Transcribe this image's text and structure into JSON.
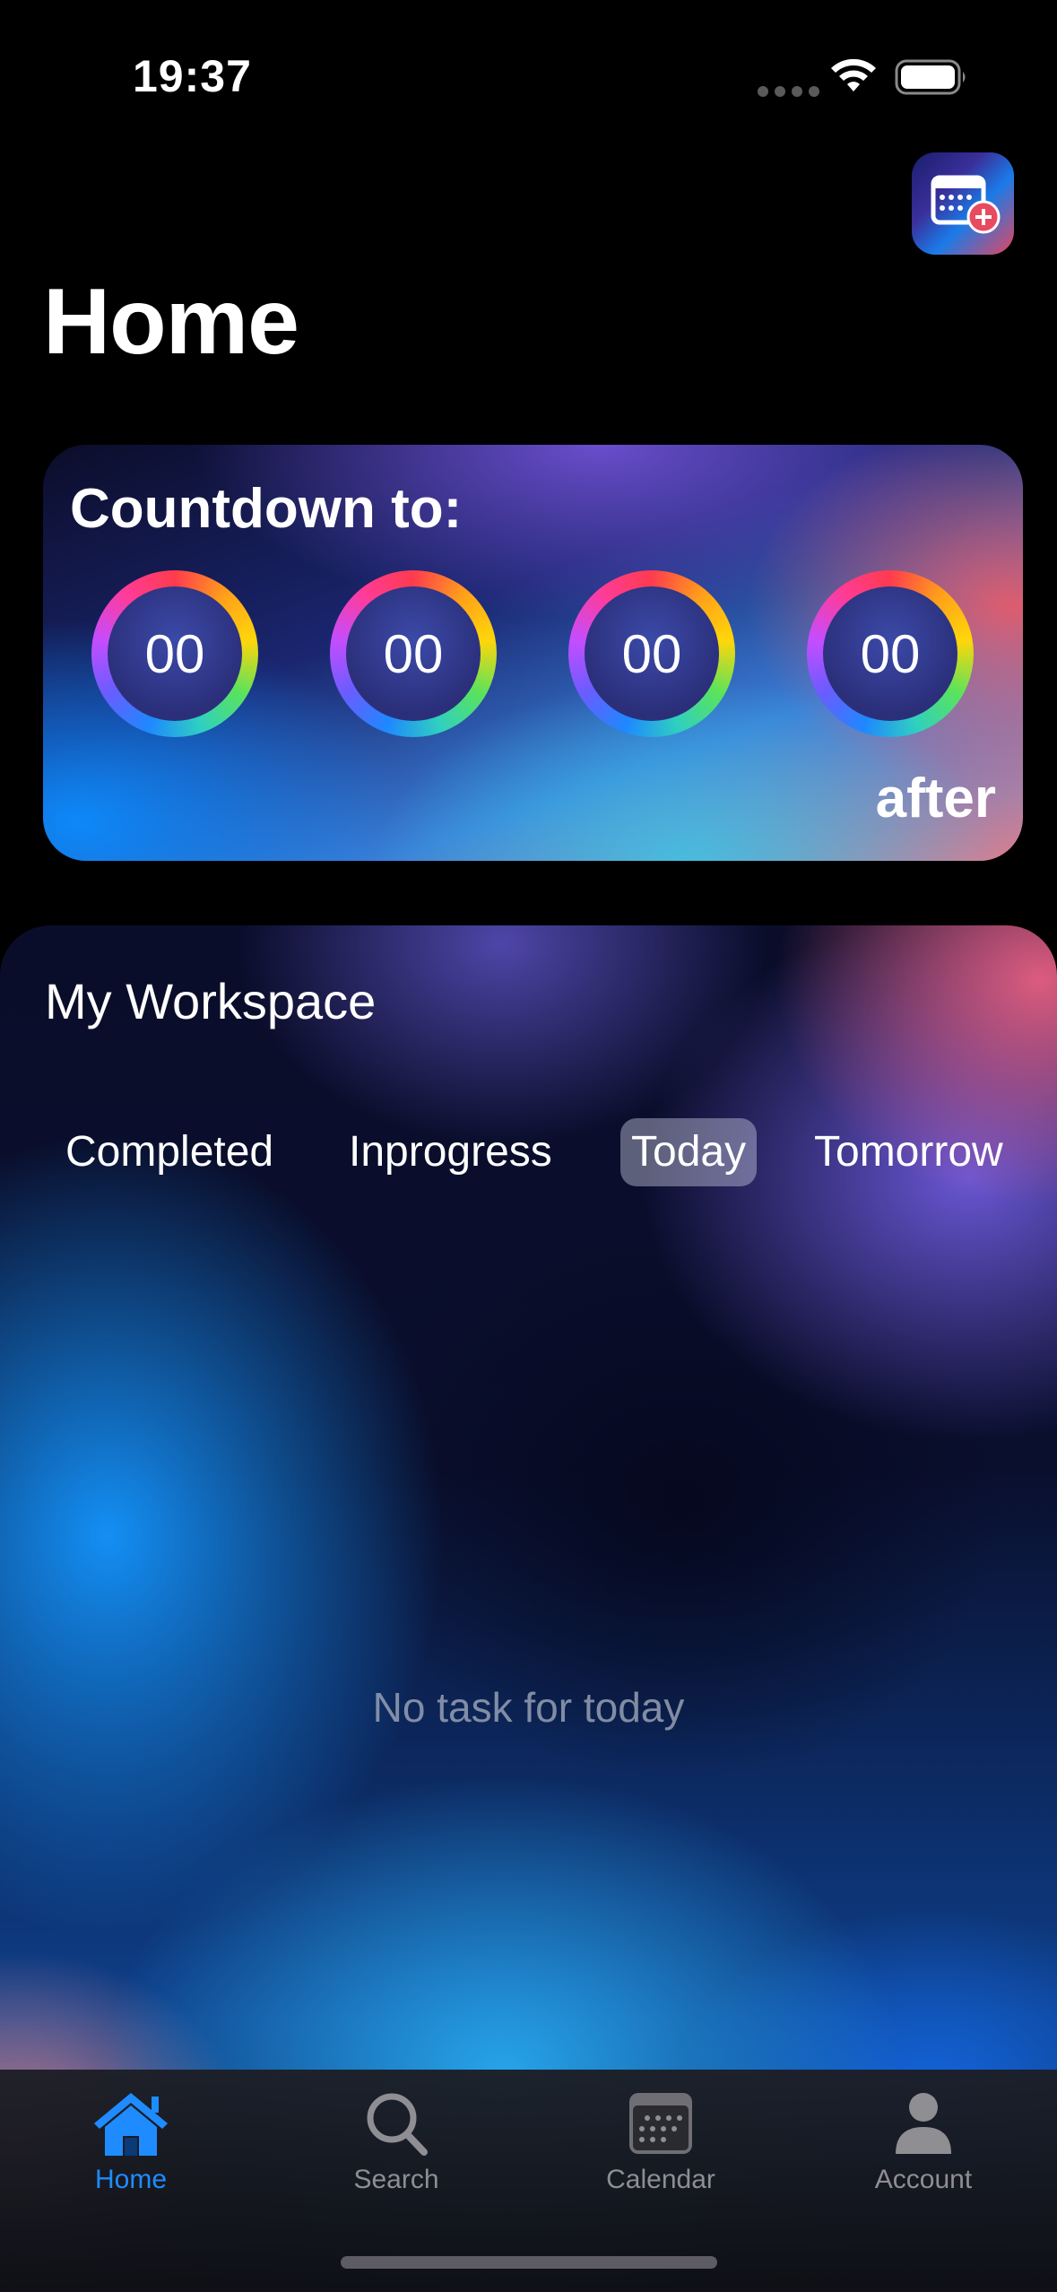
{
  "status_bar": {
    "time": "19:37"
  },
  "header": {
    "title": "Home",
    "add_event_icon": "calendar-add-icon"
  },
  "countdown": {
    "title": "Countdown to:",
    "units": [
      "00",
      "00",
      "00",
      "00"
    ],
    "footer": "after"
  },
  "workspace": {
    "title": "My Workspace",
    "tabs": [
      {
        "label": "Completed",
        "active": false
      },
      {
        "label": "Inprogress",
        "active": false
      },
      {
        "label": "Today",
        "active": true
      },
      {
        "label": "Tomorrow",
        "active": false
      }
    ],
    "empty_message": "No task for today"
  },
  "tab_bar": {
    "items": [
      {
        "label": "Home",
        "icon": "house-icon",
        "active": true
      },
      {
        "label": "Search",
        "icon": "magnifier-icon",
        "active": false
      },
      {
        "label": "Calendar",
        "icon": "calendar-icon",
        "active": false
      },
      {
        "label": "Account",
        "icon": "person-icon",
        "active": false
      }
    ],
    "active_color": "#1e8cff",
    "inactive_color": "#8e8e93"
  }
}
